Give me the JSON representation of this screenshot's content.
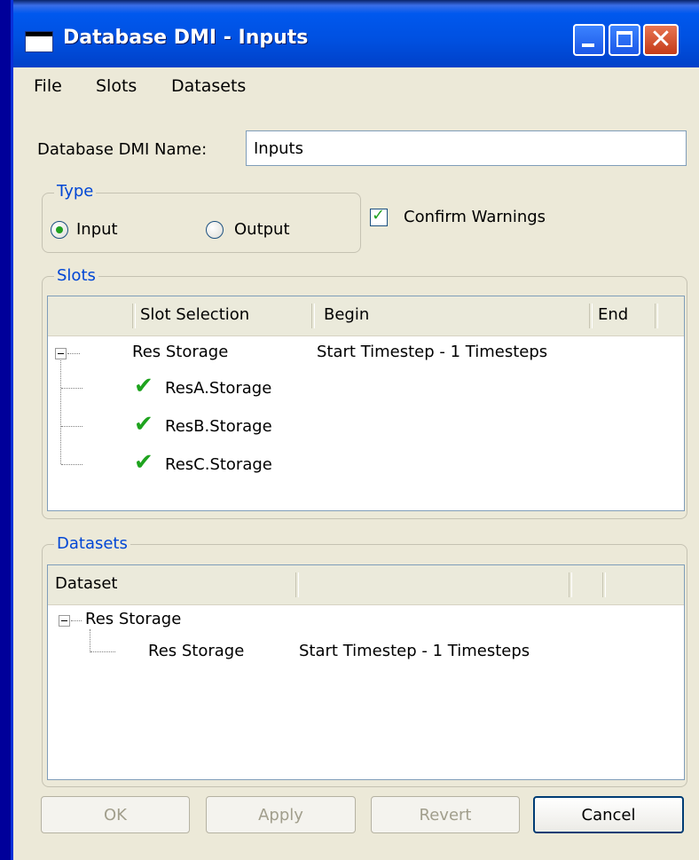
{
  "window": {
    "title": "Database DMI - Inputs"
  },
  "menu": {
    "file": "File",
    "slots": "Slots",
    "datasets": "Datasets"
  },
  "name_field": {
    "label": "Database DMI Name:",
    "value": "Inputs"
  },
  "type_group": {
    "legend": "Type",
    "input_label": "Input",
    "output_label": "Output",
    "selected": "Input"
  },
  "confirm_warnings": {
    "label": "Confirm Warnings",
    "checked": true
  },
  "slots": {
    "legend": "Slots",
    "columns": [
      "Slot Selection",
      "Begin",
      "End"
    ],
    "group": {
      "name": "Res Storage",
      "begin": "Start Timestep - 1 Timesteps"
    },
    "items": [
      "ResA.Storage",
      "ResB.Storage",
      "ResC.Storage"
    ]
  },
  "datasets": {
    "legend": "Datasets",
    "columns": [
      "Dataset"
    ],
    "group": {
      "name": "Res Storage"
    },
    "child": {
      "name": "Res Storage",
      "range": "Start Timestep - 1 Timesteps"
    }
  },
  "buttons": {
    "ok": "OK",
    "apply": "Apply",
    "revert": "Revert",
    "cancel": "Cancel"
  },
  "colors": {
    "titlebar": "#0058ee",
    "dialog_bg": "#ece9d8",
    "group_legend": "#0046d5",
    "check_green": "#1ea31e"
  }
}
